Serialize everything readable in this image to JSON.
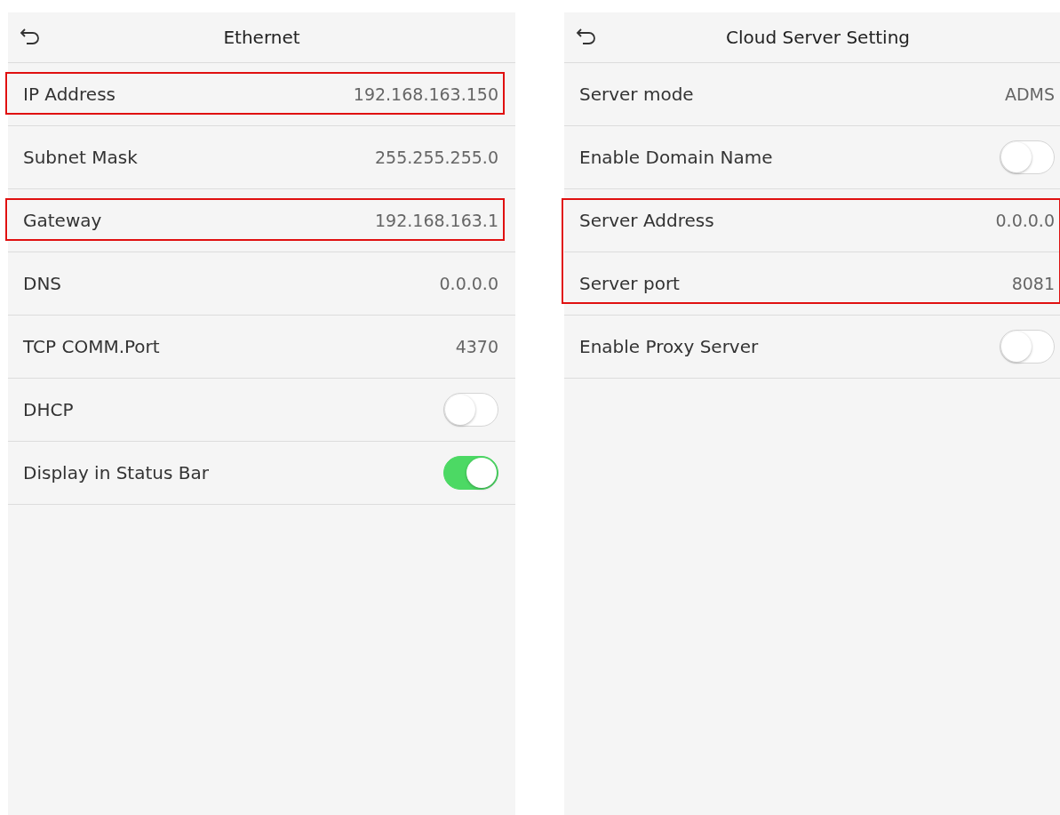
{
  "panels": [
    {
      "title": "Ethernet",
      "rows": [
        {
          "kind": "value",
          "label": "IP Address",
          "value": "192.168.163.150",
          "highlighted": true
        },
        {
          "kind": "value",
          "label": "Subnet Mask",
          "value": "255.255.255.0",
          "highlighted": false
        },
        {
          "kind": "value",
          "label": "Gateway",
          "value": "192.168.163.1",
          "highlighted": true
        },
        {
          "kind": "value",
          "label": "DNS",
          "value": "0.0.0.0",
          "highlighted": false
        },
        {
          "kind": "value",
          "label": "TCP COMM.Port",
          "value": "4370",
          "highlighted": false
        },
        {
          "kind": "toggle",
          "label": "DHCP",
          "on": false,
          "highlighted": false
        },
        {
          "kind": "toggle",
          "label": "Display in Status Bar",
          "on": true,
          "highlighted": false
        }
      ]
    },
    {
      "title": "Cloud Server Setting",
      "rows": [
        {
          "kind": "value",
          "label": "Server mode",
          "value": "ADMS",
          "highlighted": false
        },
        {
          "kind": "toggle",
          "label": "Enable Domain Name",
          "on": false,
          "highlighted": false
        },
        {
          "kind": "value",
          "label": "Server Address",
          "value": "0.0.0.0",
          "highlighted": true
        },
        {
          "kind": "value",
          "label": "Server port",
          "value": "8081",
          "highlighted": true
        },
        {
          "kind": "toggle",
          "label": "Enable Proxy Server",
          "on": false,
          "highlighted": false
        }
      ]
    }
  ]
}
